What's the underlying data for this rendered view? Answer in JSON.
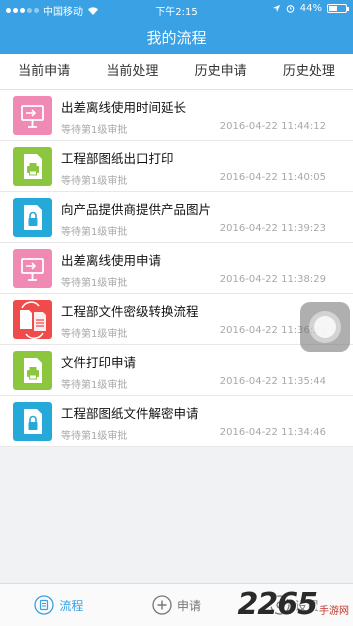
{
  "status_bar": {
    "carrier": "中国移动",
    "time": "下午2:15",
    "battery": "44%",
    "battery_level": 0.44
  },
  "header": {
    "title": "我的流程"
  },
  "tabs": [
    {
      "label": "当前申请",
      "active": true
    },
    {
      "label": "当前处理",
      "active": false
    },
    {
      "label": "历史申请",
      "active": false
    },
    {
      "label": "历史处理",
      "active": false
    }
  ],
  "items": [
    {
      "title": "出差离线使用时间延长",
      "status": "等待第1级审批",
      "time": "2016-04-22 11:44:12",
      "icon": "monitor-icon",
      "color": "#f08ab4"
    },
    {
      "title": "工程部图纸出口打印",
      "status": "等待第1级审批",
      "time": "2016-04-22 11:40:05",
      "icon": "print-document-icon",
      "color": "#8cc63f"
    },
    {
      "title": "向产品提供商提供产品图片",
      "status": "等待第1级审批",
      "time": "2016-04-22 11:39:23",
      "icon": "locked-document-icon",
      "color": "#25a9d8"
    },
    {
      "title": "出差离线使用申请",
      "status": "等待第1级审批",
      "time": "2016-04-22 11:38:29",
      "icon": "monitor-icon",
      "color": "#f08ab4"
    },
    {
      "title": "工程部文件密级转换流程",
      "status": "等待第1级审批",
      "time": "2016-04-22 11:36:25",
      "icon": "convert-documents-icon",
      "color": "#ef4b4b"
    },
    {
      "title": "文件打印申请",
      "status": "等待第1级审批",
      "time": "2016-04-22 11:35:44",
      "icon": "print-document-icon",
      "color": "#8cc63f"
    },
    {
      "title": "工程部图纸文件解密申请",
      "status": "等待第1级审批",
      "time": "2016-04-22 11:34:46",
      "icon": "locked-document-icon",
      "color": "#25a9d8"
    }
  ],
  "bottom_nav": [
    {
      "label": "流程",
      "icon": "flow-icon",
      "active": true
    },
    {
      "label": "申请",
      "icon": "apply-icon",
      "active": false
    },
    {
      "label": "设置",
      "icon": "settings-icon",
      "active": false
    }
  ],
  "watermark": {
    "number": "2265",
    "site": "手游网"
  },
  "colors": {
    "accent": "#3aa1e4",
    "header_bg": "#3aa1e4",
    "page_bg": "#f1f2f4"
  }
}
